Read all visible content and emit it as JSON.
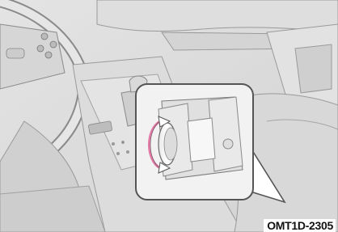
{
  "figure": {
    "code": "OMT1D-2305",
    "illustration": "car-interior-center-console-illustration",
    "callout": "drive-mode-dial-callout",
    "colors": {
      "line": "#6b6b6b",
      "fill_light": "#f0f0f0",
      "fill_mid": "#d9d9d9",
      "rotation_arrow": "#e27aa5"
    }
  }
}
